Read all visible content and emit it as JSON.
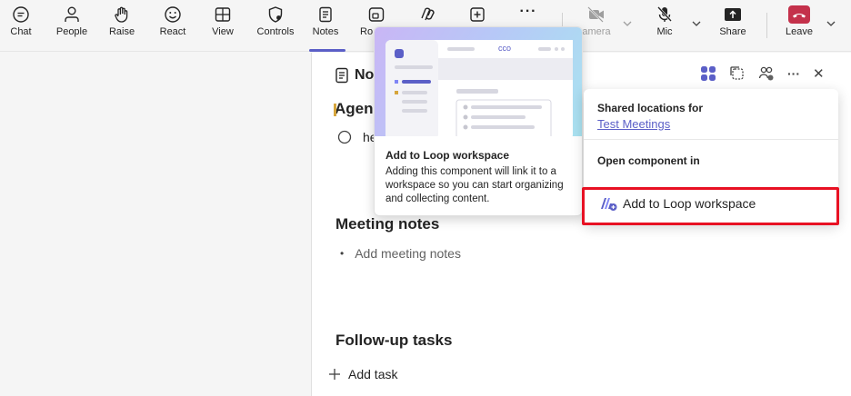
{
  "toolbar": {
    "items": [
      {
        "label": "Chat",
        "icon": "chat-icon"
      },
      {
        "label": "People",
        "icon": "people-icon"
      },
      {
        "label": "Raise",
        "icon": "raise-hand-icon"
      },
      {
        "label": "React",
        "icon": "react-icon"
      },
      {
        "label": "View",
        "icon": "view-grid-icon"
      },
      {
        "label": "Controls",
        "icon": "controls-shield-icon"
      },
      {
        "label": "Notes",
        "icon": "notes-icon"
      },
      {
        "label": "Ro",
        "icon": "rooms-icon"
      },
      {
        "label": "",
        "icon": "loop-apps-icon"
      },
      {
        "label": "",
        "icon": "add-app-icon"
      },
      {
        "label": "",
        "icon": "more-icon"
      },
      {
        "label": "amera",
        "icon": "camera-off-icon"
      },
      {
        "label": "Mic",
        "icon": "mic-off-icon"
      },
      {
        "label": "Share",
        "icon": "share-icon"
      },
      {
        "label": "Leave",
        "icon": "leave-phone-icon"
      }
    ],
    "more_glyph": "···"
  },
  "notes": {
    "title": "No",
    "agenda_title": "Agen",
    "agenda_item": "he",
    "meeting_notes_title": "Meeting notes",
    "meeting_notes_placeholder": "Add meeting notes",
    "followup_title": "Follow-up tasks",
    "add_task_label": "Add task",
    "header_more": "···",
    "header_close": "✕"
  },
  "tooltip": {
    "heading": "Add to Loop workspace",
    "body": "Adding this component will link it to a workspace so you can start organizing and collecting content.",
    "art_brand": "cco"
  },
  "menu": {
    "shared_label": "Shared locations for",
    "shared_link": "Test Meetings",
    "open_label": "Open component in",
    "add_item_label": "Add to Loop workspace"
  },
  "colors": {
    "accent": "#5b5fc7",
    "highlight": "#e81123",
    "leave": "#c4314b"
  }
}
